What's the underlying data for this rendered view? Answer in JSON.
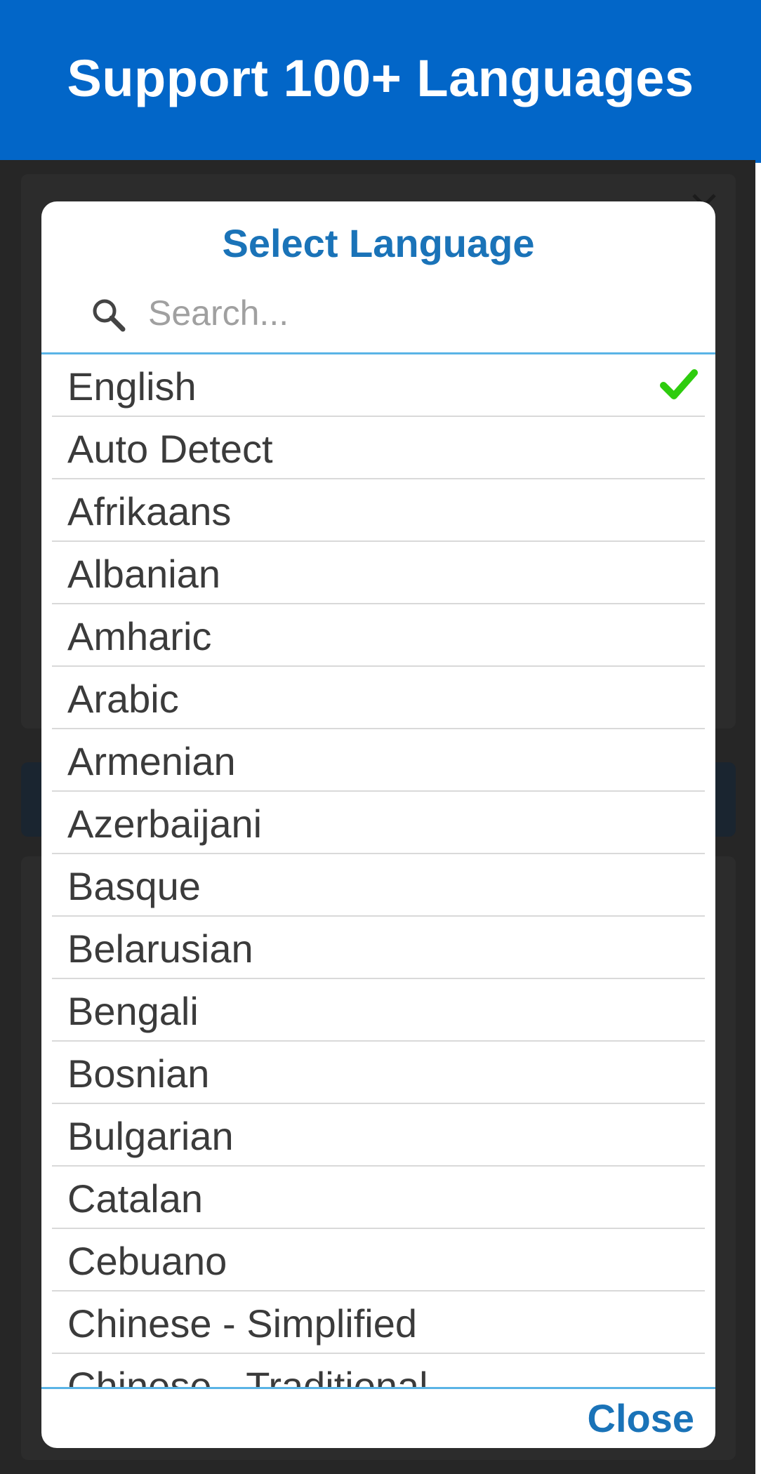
{
  "banner": {
    "title": "Support 100+ Languages",
    "color": "#0266c8"
  },
  "dialog": {
    "title": "Select Language",
    "search": {
      "value": "",
      "placeholder": "Search...",
      "icon": "search-icon"
    },
    "languages": [
      {
        "label": "English",
        "selected": true
      },
      {
        "label": "Auto Detect",
        "selected": false
      },
      {
        "label": "Afrikaans",
        "selected": false
      },
      {
        "label": "Albanian",
        "selected": false
      },
      {
        "label": "Amharic",
        "selected": false
      },
      {
        "label": "Arabic",
        "selected": false
      },
      {
        "label": "Armenian",
        "selected": false
      },
      {
        "label": "Azerbaijani",
        "selected": false
      },
      {
        "label": "Basque",
        "selected": false
      },
      {
        "label": "Belarusian",
        "selected": false
      },
      {
        "label": "Bengali",
        "selected": false
      },
      {
        "label": "Bosnian",
        "selected": false
      },
      {
        "label": "Bulgarian",
        "selected": false
      },
      {
        "label": "Catalan",
        "selected": false
      },
      {
        "label": "Cebuano",
        "selected": false
      },
      {
        "label": "Chinese - Simplified",
        "selected": false
      },
      {
        "label": "Chinese - Traditional",
        "selected": false
      }
    ],
    "selected_icon": "checkmark-icon",
    "close_label": "Close",
    "accent_color": "#1a73b8",
    "check_color": "#2ecc0e"
  }
}
